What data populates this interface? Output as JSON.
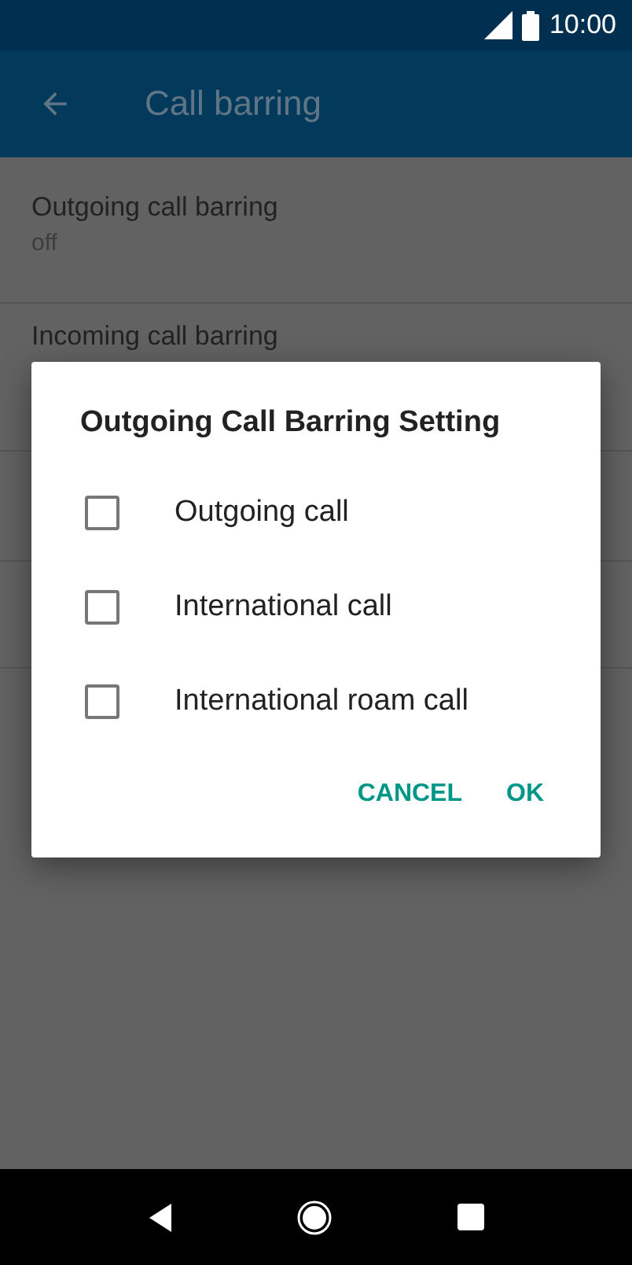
{
  "status_bar": {
    "time": "10:00"
  },
  "app_bar": {
    "title": "Call barring"
  },
  "settings": [
    {
      "title": "Outgoing call barring",
      "summary": "off"
    },
    {
      "title": "Incoming call barring"
    }
  ],
  "dialog": {
    "title": "Outgoing Call Barring Setting",
    "options": [
      {
        "label": "Outgoing call",
        "checked": false
      },
      {
        "label": "International call",
        "checked": false
      },
      {
        "label": "International roam call",
        "checked": false
      }
    ],
    "buttons": [
      "CANCEL",
      "OK"
    ]
  }
}
